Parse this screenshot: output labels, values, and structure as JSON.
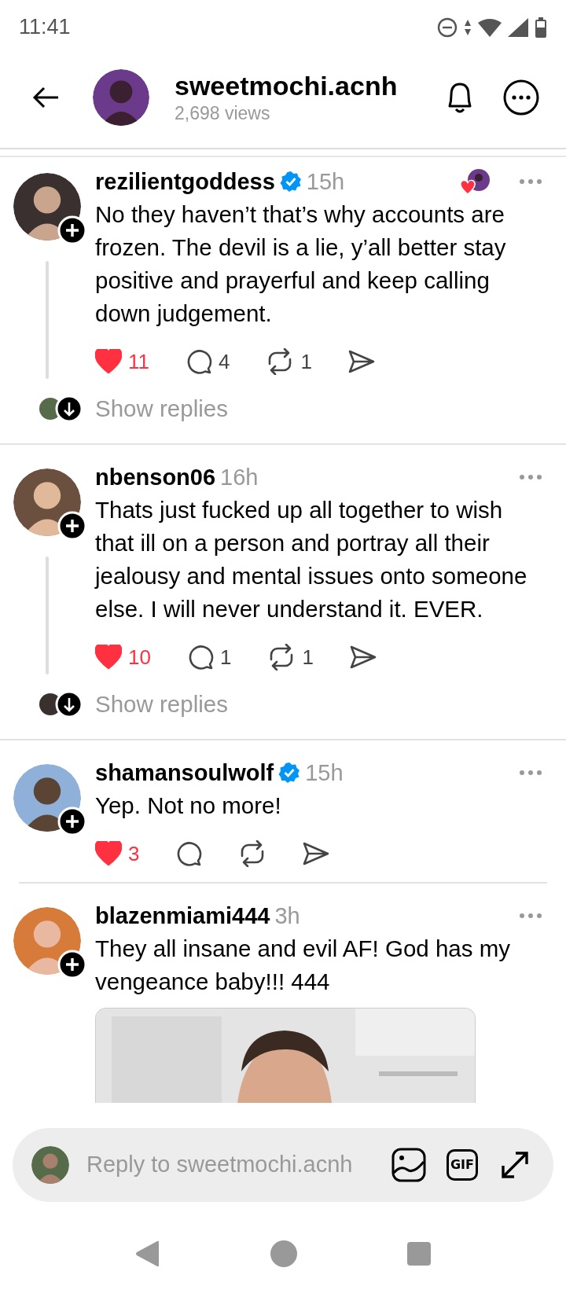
{
  "status_bar": {
    "time": "11:41"
  },
  "header": {
    "username": "sweetmochi.acnh",
    "views": "2,698 views"
  },
  "posts": [
    {
      "username": "rezilientgoddess",
      "verified": true,
      "time": "15h",
      "author_liked": true,
      "text": "No they haven’t that’s why accounts are frozen. The devil is a lie, y’all better stay positive and prayerful and keep calling down judgement.",
      "liked": true,
      "likes": "11",
      "replies": "4",
      "reposts": "1",
      "show_replies": "Show replies"
    },
    {
      "username": "nbenson06",
      "verified": false,
      "time": "16h",
      "author_liked": false,
      "text": "Thats just fucked up all together to wish that ill on a person and portray all their jealousy and mental issues onto someone else. I will never understand it. EVER.",
      "liked": true,
      "likes": "10",
      "replies": "1",
      "reposts": "1",
      "show_replies": "Show replies"
    },
    {
      "username": "shamansoulwolf",
      "verified": true,
      "time": "15h",
      "author_liked": false,
      "text": "Yep. Not no more!",
      "liked": true,
      "likes": "3"
    },
    {
      "username": "blazenmiami444",
      "verified": false,
      "time": "3h",
      "author_liked": false,
      "text": "They all insane and evil AF! God has my vengeance baby!!! 444"
    }
  ],
  "reply_bar": {
    "placeholder": "Reply to sweetmochi.acnh",
    "gif_label": "GIF"
  }
}
